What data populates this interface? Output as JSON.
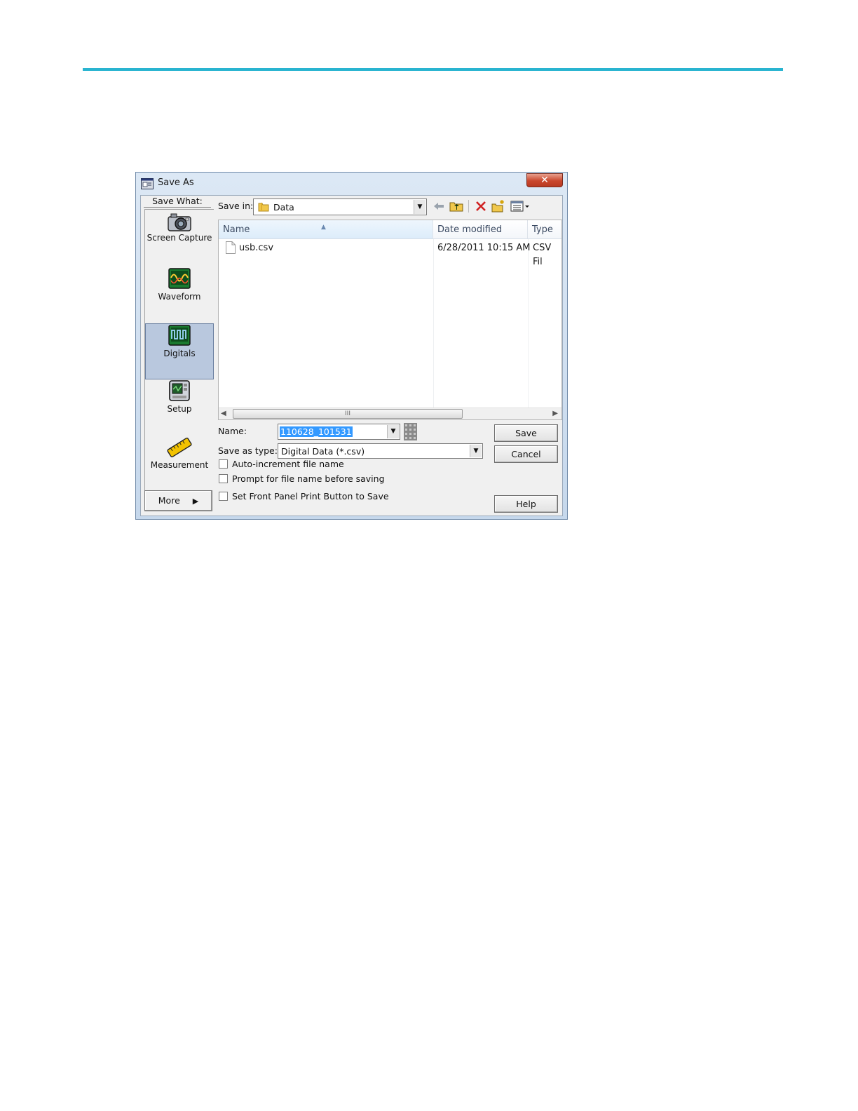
{
  "dialog": {
    "title": "Save As",
    "close_glyph": "✕"
  },
  "save_what": {
    "label": "Save What:",
    "categories": [
      {
        "label": "Screen Capture",
        "icon": "camera-icon"
      },
      {
        "label": "Waveform",
        "icon": "waveform-icon"
      },
      {
        "label": "Digitals",
        "icon": "digitals-icon",
        "selected": true
      },
      {
        "label": "Setup",
        "icon": "setup-icon"
      },
      {
        "label": "Measurement",
        "icon": "ruler-icon"
      }
    ],
    "more_label": "More"
  },
  "save_in": {
    "label": "Save in:",
    "value": "Data"
  },
  "file_list": {
    "columns": [
      "Name",
      "Date modified",
      "Type"
    ],
    "rows": [
      {
        "name": "usb.csv",
        "date": "6/28/2011 10:15 AM",
        "type": "CSV Fil"
      }
    ],
    "scroll_thumb_glyph": "III"
  },
  "form": {
    "name_label": "Name:",
    "name_value": "110628_101531",
    "type_label": "Save as type:",
    "type_value": "Digital Data (*.csv)",
    "options": [
      {
        "label": "Auto-increment file name",
        "checked": false
      },
      {
        "label": "Prompt for file name before saving",
        "checked": false
      },
      {
        "label": "Set Front Panel Print Button to Save",
        "checked": false
      }
    ]
  },
  "buttons": {
    "save": "Save",
    "cancel": "Cancel",
    "help": "Help"
  },
  "colors": {
    "accent_rule": "#29b4d0",
    "selection": "#3399ff",
    "selected_category": "#b9c8de",
    "close_button": "#c9462c"
  }
}
